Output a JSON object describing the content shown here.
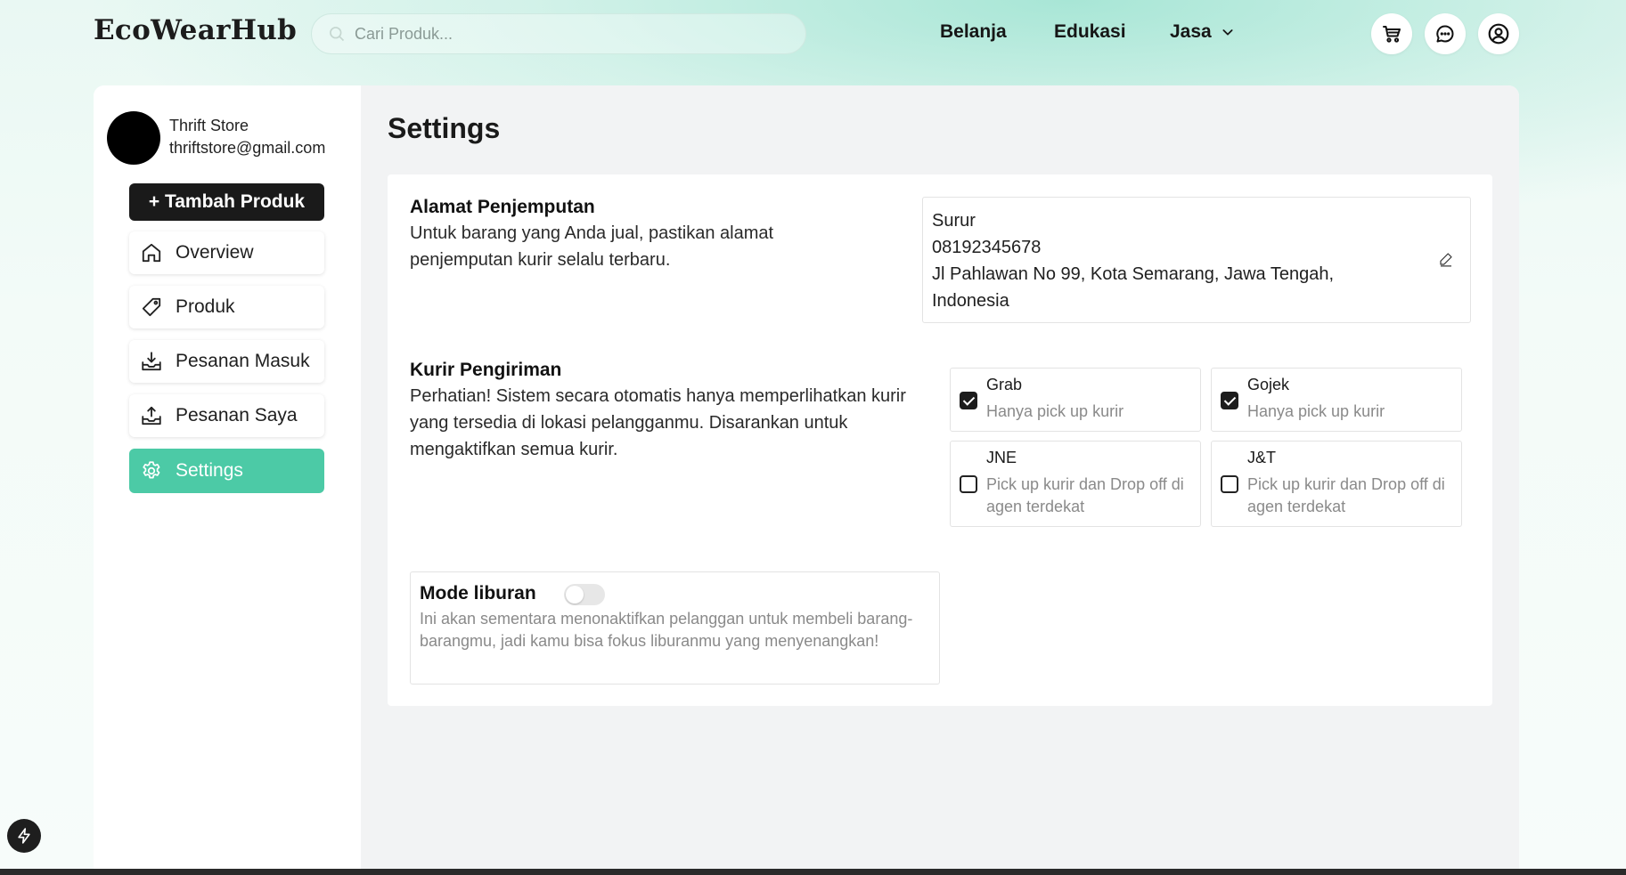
{
  "header": {
    "logo": "EcoWearHub",
    "search_placeholder": "Cari Produk...",
    "nav": {
      "belanja": "Belanja",
      "edukasi": "Edukasi",
      "jasa": "Jasa"
    },
    "icons": [
      "cart-icon",
      "chat-icon",
      "user-icon"
    ]
  },
  "sidebar": {
    "store_name": "Thrift Store",
    "store_email": "thriftstore@gmail.com",
    "add_button": "+ Tambah Produk",
    "items": [
      {
        "label": "Overview",
        "icon": "home-icon"
      },
      {
        "label": "Produk",
        "icon": "tag-icon"
      },
      {
        "label": "Pesanan Masuk",
        "icon": "inbox-download-icon"
      },
      {
        "label": "Pesanan Saya",
        "icon": "outbox-upload-icon"
      },
      {
        "label": "Settings",
        "icon": "gear-icon",
        "active": true
      }
    ]
  },
  "main": {
    "title": "Settings",
    "pickup": {
      "title": "Alamat Penjemputan",
      "desc": "Untuk barang yang Anda jual, pastikan alamat penjemputan kurir selalu terbaru.",
      "name": "Surur",
      "phone": "08192345678",
      "address": "Jl Pahlawan No 99, Kota Semarang, Jawa Tengah, Indonesia"
    },
    "courier": {
      "title": "Kurir Pengiriman",
      "desc": "Perhatian! Sistem secara otomatis hanya memperlihatkan kurir yang tersedia di lokasi pelangganmu. Disarankan untuk mengaktifkan semua kurir.",
      "options": [
        {
          "name": "Grab",
          "desc": "Hanya pick up kurir",
          "checked": true
        },
        {
          "name": "Gojek",
          "desc": "Hanya pick up kurir",
          "checked": true
        },
        {
          "name": "JNE",
          "desc": "Pick up kurir dan Drop off di agen terdekat",
          "checked": false
        },
        {
          "name": "J&T",
          "desc": "Pick up kurir dan Drop off di agen terdekat",
          "checked": false
        }
      ]
    },
    "vacation": {
      "title": "Mode liburan",
      "enabled": false,
      "desc": "Ini akan sementara menonaktifkan pelanggan untuk membeli barang-barangmu, jadi kamu bisa fokus liburanmu yang menyenangkan!"
    }
  },
  "colors": {
    "accent": "#4ccaa6",
    "dark_button": "#1a1a1a",
    "main_bg": "#f2f3f4"
  }
}
